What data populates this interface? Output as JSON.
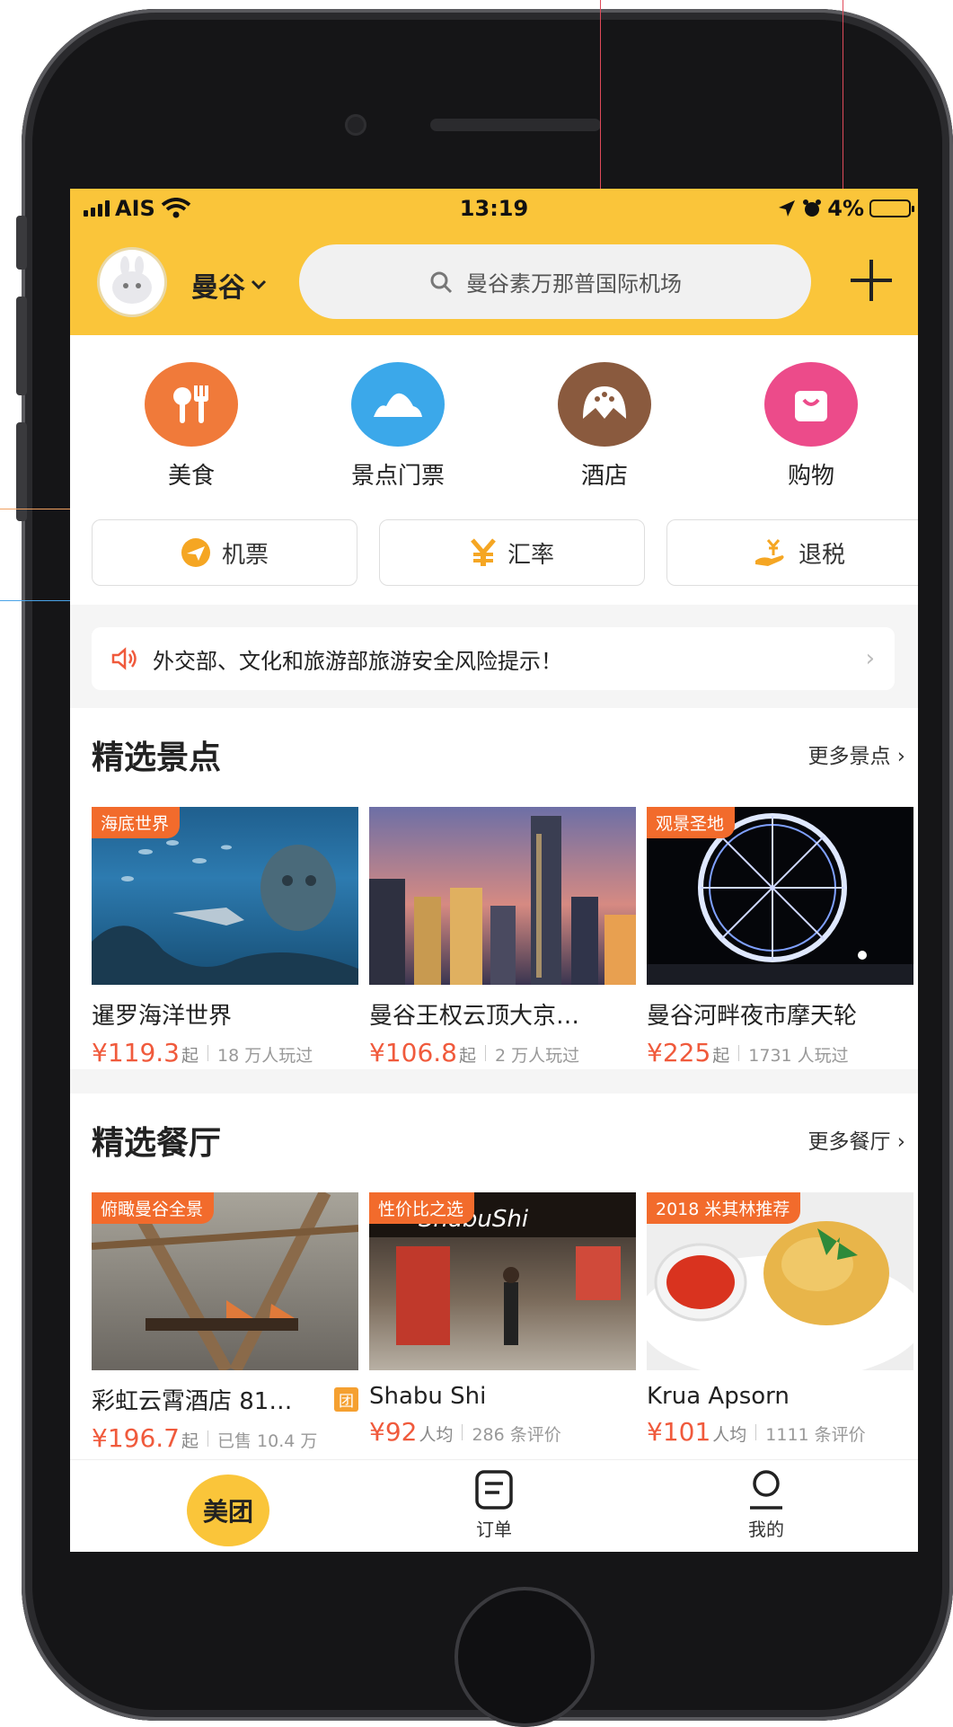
{
  "status_bar": {
    "carrier": "AIS",
    "time": "13:19",
    "battery": "4%"
  },
  "header": {
    "city": "曼谷",
    "search_placeholder": "曼谷素万那普国际机场"
  },
  "categories": [
    {
      "label": "美食",
      "icon": "utensils-icon",
      "color": "#f07a3a"
    },
    {
      "label": "景点门票",
      "icon": "mountain-icon",
      "color": "#3ba8ea"
    },
    {
      "label": "酒店",
      "icon": "hotel-icon",
      "color": "#8a5a3e"
    },
    {
      "label": "购物",
      "icon": "shopping-bag-icon",
      "color": "#ec4b8a"
    }
  ],
  "utilities": [
    {
      "label": "机票",
      "icon": "plane-icon"
    },
    {
      "label": "汇率",
      "icon": "yen-icon"
    },
    {
      "label": "退税",
      "icon": "tax-refund-icon"
    }
  ],
  "notice": {
    "text": "外交部、文化和旅游部旅游安全风险提示！"
  },
  "attractions": {
    "title": "精选景点",
    "more": "更多景点",
    "items": [
      {
        "tag": "海底世界",
        "name": "暹罗海洋世界",
        "price": "¥119.3",
        "unit": "起",
        "stat": "18 万人玩过"
      },
      {
        "tag": "",
        "name": "曼谷王权云顶大京…",
        "price": "¥106.8",
        "unit": "起",
        "stat": "2 万人玩过"
      },
      {
        "tag": "观景圣地",
        "name": "曼谷河畔夜市摩天轮",
        "price": "¥225",
        "unit": "起",
        "stat": "1731 人玩过"
      }
    ]
  },
  "restaurants": {
    "title": "精选餐厅",
    "more": "更多餐厅",
    "items": [
      {
        "tag": "俯瞰曼谷全景",
        "name": "彩虹云霄酒店 81…",
        "badge": "团",
        "price": "¥196.7",
        "unit": "起",
        "stat": "已售 10.4 万"
      },
      {
        "tag": "性价比之选",
        "name": "Shabu Shi",
        "badge": "",
        "price": "¥92",
        "unit": "人均",
        "stat": "286 条评价"
      },
      {
        "tag": "2018 米其林推荐",
        "name": "Krua Apsorn",
        "badge": "",
        "price": "¥101",
        "unit": "人均",
        "stat": "1111 条评价"
      }
    ]
  },
  "tabbar": {
    "home": "美团",
    "orders": "订单",
    "mine": "我的"
  },
  "colors": {
    "brand": "#fac53a",
    "price": "#f05a3c",
    "tag": "#f26b2c"
  }
}
